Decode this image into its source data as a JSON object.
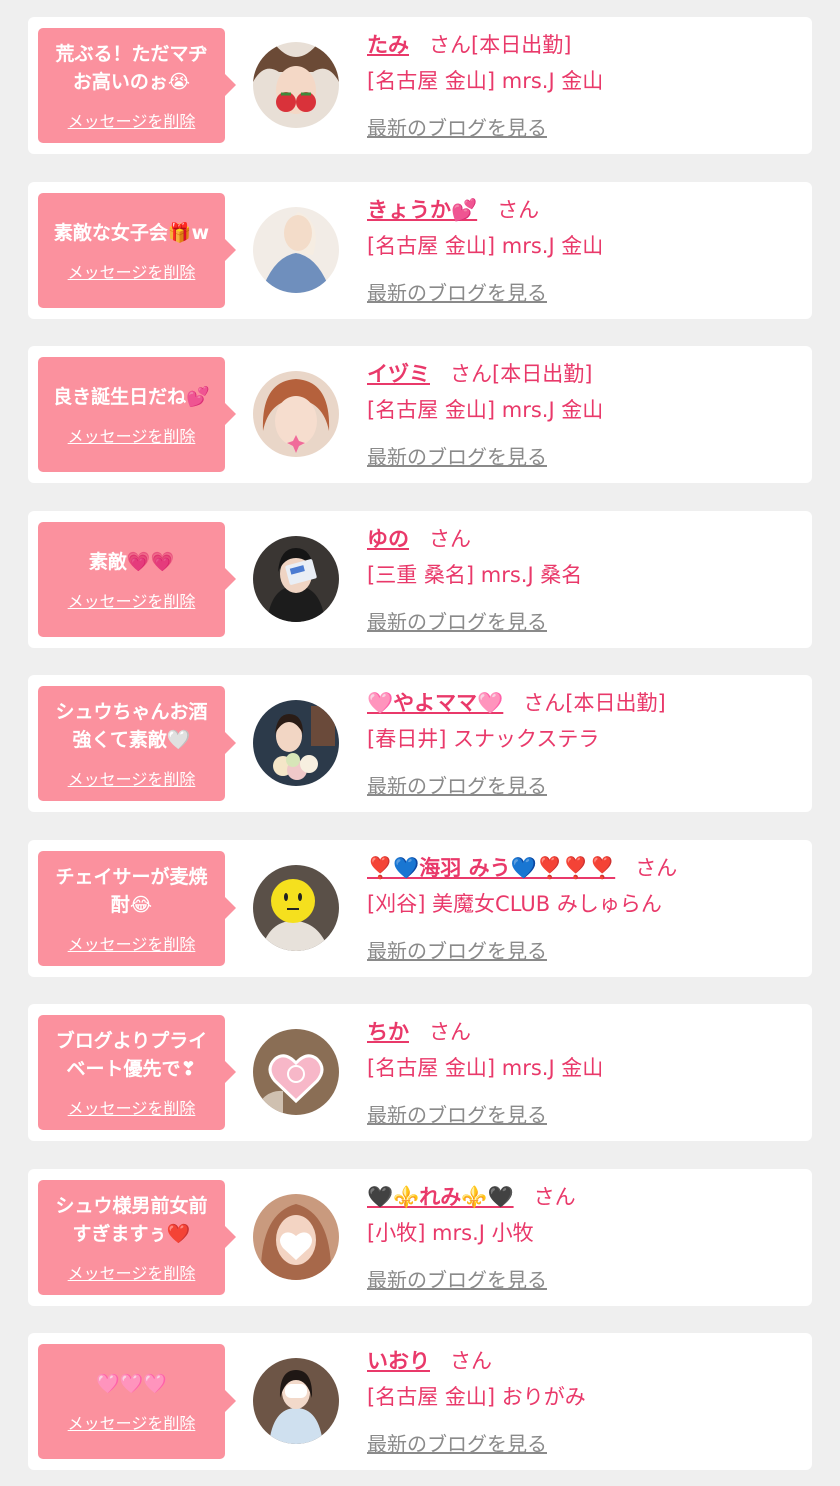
{
  "common": {
    "delete_label": "メッセージを削除",
    "blog_label": "最新のブログを見る",
    "honorific": "さん"
  },
  "colors": {
    "accent": "#e9396a",
    "bubble": "#fb919e",
    "background": "#efefef",
    "muted": "#8a8a8a"
  },
  "messages": [
    {
      "message": "荒ぶる！ただマヂ\nお高いのぉ😭",
      "name": "たみ",
      "suffix": "さん[本日出勤]",
      "shop": "[名古屋 金山] mrs.J 金山",
      "avatar_icon": "avatar-photo-icon"
    },
    {
      "message": "素敵な女子会🎁w",
      "name": "きょうか💕",
      "suffix": "さん",
      "shop": "[名古屋 金山] mrs.J 金山",
      "avatar_icon": "avatar-photo-icon"
    },
    {
      "message": "良き誕生日だね💕",
      "name": "イヅミ",
      "suffix": "さん[本日出勤]",
      "shop": "[名古屋 金山] mrs.J 金山",
      "avatar_icon": "avatar-photo-icon"
    },
    {
      "message": "素敵💗💗",
      "name": "ゆの",
      "suffix": "さん",
      "shop": "[三重 桑名] mrs.J 桑名",
      "avatar_icon": "avatar-photo-icon"
    },
    {
      "message": "シュウちゃんお酒\n強くて素敵🤍",
      "name": "🩷やよママ🩷",
      "suffix": "さん[本日出勤]",
      "shop": "[春日井] スナックステラ",
      "avatar_icon": "avatar-photo-icon"
    },
    {
      "message": "チェイサーが麦焼\n酎😂",
      "name": "❣️💙海羽 みう💙❣️❣️❣️",
      "suffix": "さん",
      "shop": "[刈谷] 美魔女CLUB みしゅらん",
      "avatar_icon": "avatar-photo-icon"
    },
    {
      "message": "ブログよりプライ\nベート優先で❣",
      "name": "ちか",
      "suffix": "さん",
      "shop": "[名古屋 金山] mrs.J 金山",
      "avatar_icon": "avatar-photo-icon"
    },
    {
      "message": "シュウ様男前女前\nすぎますぅ❤️",
      "name": "🖤⚜️れみ⚜️🖤",
      "suffix": "さん",
      "shop": "[小牧] mrs.J 小牧",
      "avatar_icon": "avatar-photo-icon"
    },
    {
      "message": "🩷🩷🩷",
      "name": "いおり",
      "suffix": "さん",
      "shop": "[名古屋 金山] おりがみ",
      "avatar_icon": "avatar-photo-icon"
    }
  ]
}
